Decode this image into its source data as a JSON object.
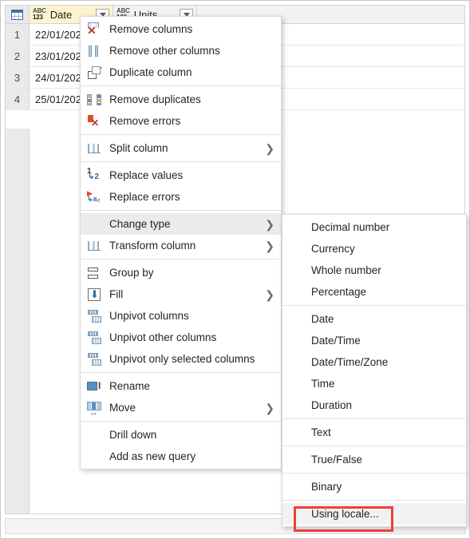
{
  "grid": {
    "corner_icon": "table-icon",
    "columns": [
      {
        "name": "Date",
        "type_icon_top": "ABC",
        "type_icon_bottom": "123",
        "selected": true
      },
      {
        "name": "Units",
        "type_icon_top": "ABC",
        "type_icon_bottom": "123",
        "selected": false
      }
    ],
    "rows": [
      {
        "num": "1",
        "date": "22/01/202",
        "units": ""
      },
      {
        "num": "2",
        "date": "23/01/202",
        "units": ""
      },
      {
        "num": "3",
        "date": "24/01/202",
        "units": ""
      },
      {
        "num": "4",
        "date": "25/01/202",
        "units": ""
      }
    ]
  },
  "context_menu": {
    "groups": [
      [
        {
          "label": "Remove columns",
          "icon": "remove-columns-icon",
          "submenu": false,
          "highlighted": false
        },
        {
          "label": "Remove other columns",
          "icon": "remove-other-columns-icon",
          "submenu": false,
          "highlighted": false
        },
        {
          "label": "Duplicate column",
          "icon": "duplicate-column-icon",
          "submenu": false,
          "highlighted": false
        }
      ],
      [
        {
          "label": "Remove duplicates",
          "icon": "remove-duplicates-icon",
          "submenu": false,
          "highlighted": false
        },
        {
          "label": "Remove errors",
          "icon": "remove-errors-icon",
          "submenu": false,
          "highlighted": false
        }
      ],
      [
        {
          "label": "Split column",
          "icon": "split-column-icon",
          "submenu": true,
          "highlighted": false
        }
      ],
      [
        {
          "label": "Replace values",
          "icon": "replace-values-icon",
          "submenu": false,
          "highlighted": false
        },
        {
          "label": "Replace errors",
          "icon": "replace-errors-icon",
          "submenu": false,
          "highlighted": false
        }
      ],
      [
        {
          "label": "Change type",
          "icon": "",
          "submenu": true,
          "highlighted": true
        },
        {
          "label": "Transform column",
          "icon": "transform-column-icon",
          "submenu": true,
          "highlighted": false
        }
      ],
      [
        {
          "label": "Group by",
          "icon": "group-by-icon",
          "submenu": false,
          "highlighted": false
        },
        {
          "label": "Fill",
          "icon": "fill-icon",
          "submenu": true,
          "highlighted": false
        },
        {
          "label": "Unpivot columns",
          "icon": "unpivot-columns-icon",
          "submenu": false,
          "highlighted": false
        },
        {
          "label": "Unpivot other columns",
          "icon": "unpivot-other-columns-icon",
          "submenu": false,
          "highlighted": false
        },
        {
          "label": "Unpivot only selected columns",
          "icon": "unpivot-selected-icon",
          "submenu": false,
          "highlighted": false
        }
      ],
      [
        {
          "label": "Rename",
          "icon": "rename-icon",
          "submenu": false,
          "highlighted": false
        },
        {
          "label": "Move",
          "icon": "move-icon",
          "submenu": true,
          "highlighted": false
        }
      ],
      [
        {
          "label": "Drill down",
          "icon": "",
          "submenu": false,
          "highlighted": false
        },
        {
          "label": "Add as new query",
          "icon": "",
          "submenu": false,
          "highlighted": false
        }
      ]
    ]
  },
  "change_type_submenu": {
    "groups": [
      [
        {
          "label": "Decimal number",
          "highlighted": false
        },
        {
          "label": "Currency",
          "highlighted": false
        },
        {
          "label": "Whole number",
          "highlighted": false
        },
        {
          "label": "Percentage",
          "highlighted": false
        }
      ],
      [
        {
          "label": "Date",
          "highlighted": false
        },
        {
          "label": "Date/Time",
          "highlighted": false
        },
        {
          "label": "Date/Time/Zone",
          "highlighted": false
        },
        {
          "label": "Time",
          "highlighted": false
        },
        {
          "label": "Duration",
          "highlighted": false
        }
      ],
      [
        {
          "label": "Text",
          "highlighted": false
        }
      ],
      [
        {
          "label": "True/False",
          "highlighted": false
        }
      ],
      [
        {
          "label": "Binary",
          "highlighted": false
        }
      ],
      [
        {
          "label": "Using locale...",
          "highlighted": true
        }
      ]
    ]
  },
  "annotation": {
    "target_label": "Using locale...",
    "color": "#ef3e3e"
  },
  "colors": {
    "selected_column_header": "#fdf4cd",
    "menu_highlight": "#ebebeb",
    "annotation_red": "#ef3e3e"
  }
}
